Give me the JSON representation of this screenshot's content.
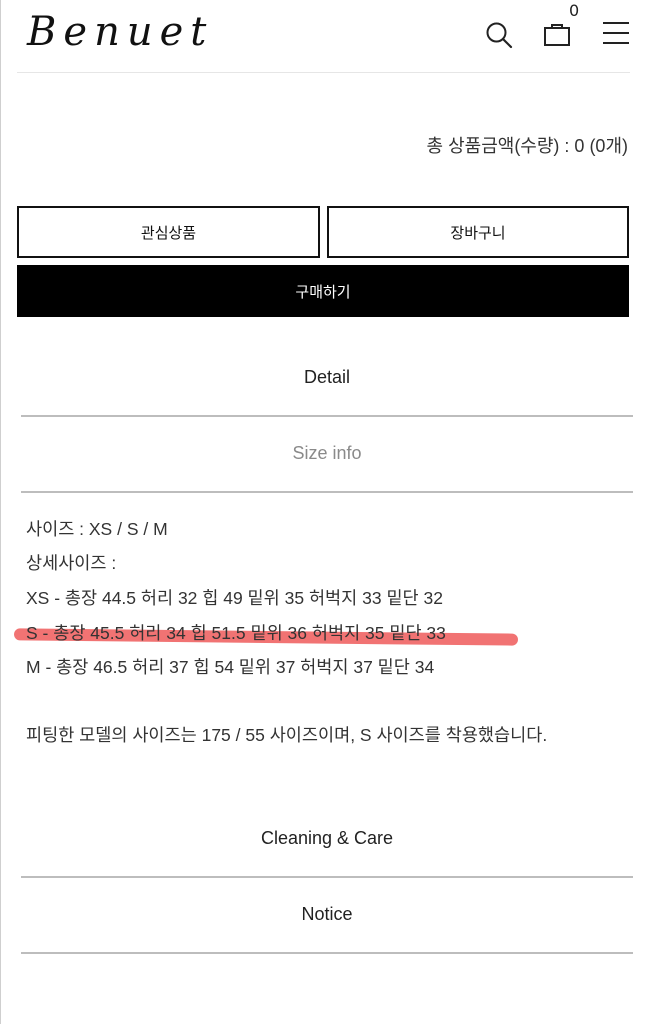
{
  "header": {
    "logo": "Benuet",
    "cart_count": "0",
    "icons": [
      "search-icon",
      "shopping-bag-icon",
      "menu-icon"
    ]
  },
  "summary": {
    "total_label": "총 상품금액(수량) : 0 (0개)"
  },
  "buttons": {
    "wishlist": "관심상품",
    "cart": "장바구니",
    "buy": "구매하기"
  },
  "tabs": {
    "detail": "Detail",
    "size_info": "Size info",
    "cleaning_care": "Cleaning & Care",
    "notice": "Notice"
  },
  "size_info": {
    "sizes": "사이즈 : XS / S / M",
    "detail_label": "상세사이즈 :",
    "rows": [
      "XS - 총장 44.5 허리 32 힙 49 밑위 35 허벅지 33 밑단 32",
      "S - 총장 45.5 허리 34 힙 51.5 밑위 36 허벅지 35 밑단 33",
      "M - 총장 46.5 허리 37 힙 54 밑위 37 허벅지 37 밑단 34"
    ],
    "model_note": "피팅한 모델의 사이즈는 175 / 55 사이즈이며, S 사이즈를 착용했습니다."
  },
  "colors": {
    "highlight": "#f06464",
    "buy_button": "#000000"
  }
}
